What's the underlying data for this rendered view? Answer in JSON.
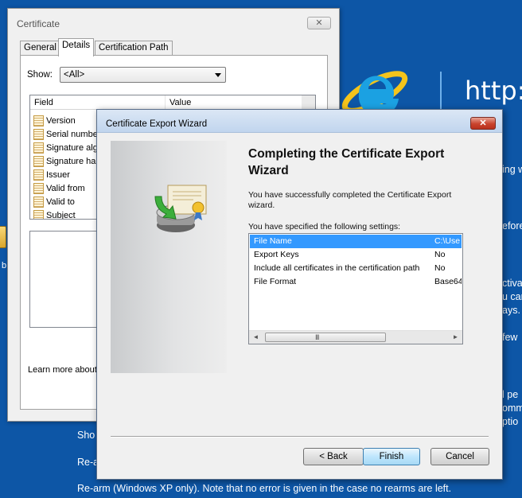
{
  "background": {
    "url_text": "http:",
    "right_fragments": [
      {
        "text": "ing w"
      },
      {
        "text": "efore"
      },
      {
        "text": "ctiva"
      },
      {
        "text": "u car"
      },
      {
        "text": "ays."
      },
      {
        "text": "few"
      },
      {
        "text": "l pe"
      },
      {
        "text": "omm"
      },
      {
        "text": "ptio"
      }
    ],
    "lines": {
      "show": "Sho",
      "rearm_short": "Re-a",
      "rearm_full": "Re-arm (Windows XP only). Note that no error is given in the case no rearms are left."
    },
    "desktop_icon_label": "b"
  },
  "certificate": {
    "title": "Certificate",
    "close_label": "✕",
    "tabs": [
      {
        "label": "General"
      },
      {
        "label": "Details"
      },
      {
        "label": "Certification Path"
      }
    ],
    "show_label": "Show:",
    "show_value": "<All>",
    "columns": {
      "field": "Field",
      "value": "Value"
    },
    "fields": [
      {
        "label": "Version"
      },
      {
        "label": "Serial numbe"
      },
      {
        "label": "Signature alg"
      },
      {
        "label": "Signature ha"
      },
      {
        "label": "Issuer"
      },
      {
        "label": "Valid from"
      },
      {
        "label": "Valid to"
      },
      {
        "label": "Subject"
      }
    ],
    "learn_more": "Learn more about"
  },
  "wizard": {
    "title": "Certificate Export Wizard",
    "heading": "Completing the Certificate Export Wizard",
    "description": "You have successfully completed the Certificate Export wizard.",
    "settings_intro": "You have specified the following settings:",
    "settings": [
      {
        "name": "File Name",
        "value": "C:\\Use",
        "selected": true
      },
      {
        "name": "Export Keys",
        "value": "No",
        "selected": false
      },
      {
        "name": "Include all certificates in the certification path",
        "value": "No",
        "selected": false
      },
      {
        "name": "File Format",
        "value": "Base64",
        "selected": false
      }
    ],
    "scroll_left": "◄",
    "scroll_right": "►",
    "scroll_grip": "III",
    "buttons": {
      "back": "< Back",
      "finish": "Finish",
      "cancel": "Cancel"
    }
  },
  "colors": {
    "desktop": "#0d56a6",
    "selection": "#3399ff",
    "close_red": "#c9432d"
  }
}
